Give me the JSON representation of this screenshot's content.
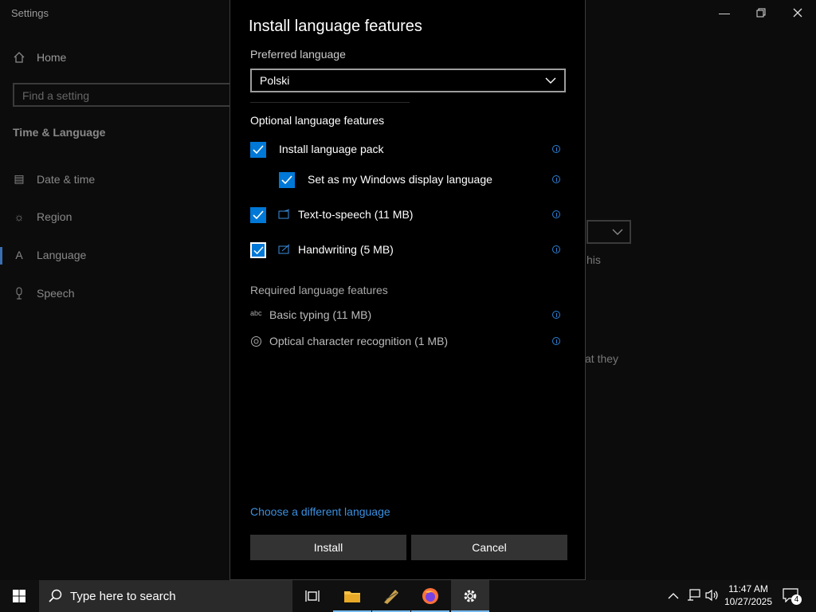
{
  "window": {
    "title": "Settings"
  },
  "sidebar": {
    "home": "Home",
    "search_placeholder": "Find a setting",
    "section": "Time & Language",
    "items": [
      {
        "label": "Date & time",
        "icon": "calendar-clock-icon"
      },
      {
        "label": "Region",
        "icon": "globe-icon"
      },
      {
        "label": "Language",
        "icon": "language-icon",
        "selected": true
      },
      {
        "label": "Speech",
        "icon": "microphone-icon"
      }
    ]
  },
  "background_text": {
    "line1": "his",
    "line2": "at they"
  },
  "dialog": {
    "title": "Install language features",
    "preferred_label": "Preferred language",
    "preferred_value": "Polski",
    "optional_header": "Optional language features",
    "optional": [
      {
        "label": "Install language pack",
        "checked": true
      },
      {
        "label": "Set as my Windows display language",
        "checked": true
      },
      {
        "label": "Text-to-speech (11 MB)",
        "checked": true,
        "icon": "speech-icon"
      },
      {
        "label": "Handwriting (5 MB)",
        "checked": true,
        "icon": "handwriting-icon"
      }
    ],
    "required_header": "Required language features",
    "required": [
      {
        "label": "Basic typing (11 MB)",
        "icon": "abc-typing-icon"
      },
      {
        "label": "Optical character recognition (1 MB)",
        "icon": "ocr-icon"
      }
    ],
    "link": "Choose a different language",
    "install_button": "Install",
    "cancel_button": "Cancel"
  },
  "taskbar": {
    "search_placeholder": "Type here to search",
    "time": "11:47 AM",
    "date": "10/27/2025",
    "notification_count": "4"
  },
  "colors": {
    "accent": "#0078d7",
    "link": "#3b8fe0",
    "info": "#2d7fd3"
  }
}
